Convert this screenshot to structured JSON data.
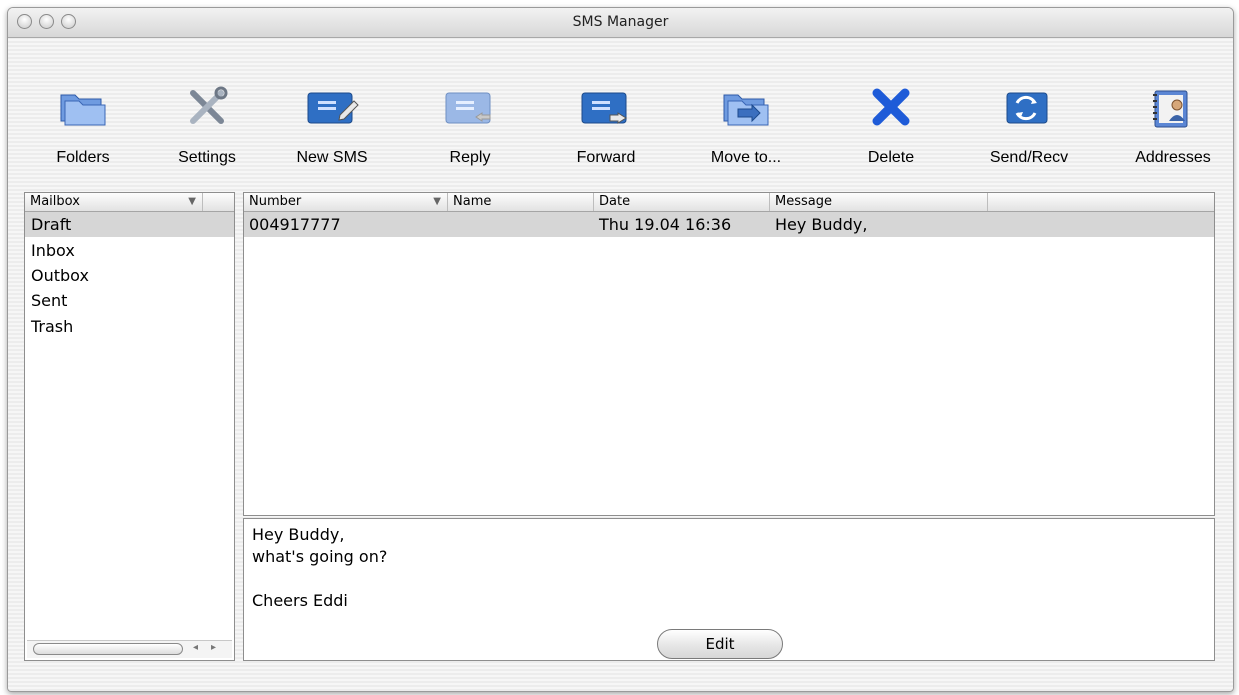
{
  "window": {
    "title": "SMS Manager"
  },
  "toolbar": {
    "items": [
      {
        "label": "Folders",
        "icon": "folders-icon"
      },
      {
        "label": "Settings",
        "icon": "settings-icon"
      },
      {
        "label": "New SMS",
        "icon": "new-sms-icon"
      },
      {
        "label": "Reply",
        "icon": "reply-icon"
      },
      {
        "label": "Forward",
        "icon": "forward-icon"
      },
      {
        "label": "Move to...",
        "icon": "move-to-icon"
      },
      {
        "label": "Delete",
        "icon": "delete-icon"
      },
      {
        "label": "Send/Recv",
        "icon": "send-recv-icon"
      },
      {
        "label": "Addresses",
        "icon": "addresses-icon"
      }
    ]
  },
  "mailbox": {
    "header": "Mailbox",
    "items": [
      "Draft",
      "Inbox",
      "Outbox",
      "Sent",
      "Trash"
    ],
    "selected": "Draft"
  },
  "messages": {
    "columns": [
      "Number",
      "Name",
      "Date",
      "Message"
    ],
    "rows": [
      {
        "number": "004917777",
        "name": "",
        "date": "Thu 19.04 16:36",
        "message": "Hey Buddy,"
      }
    ]
  },
  "preview": {
    "lines": [
      "Hey Buddy,",
      "what's going on?",
      "",
      "Cheers Eddi"
    ]
  },
  "edit_button": {
    "label": "Edit"
  },
  "colors": {
    "accent_blue": "#2f6fc4",
    "selection_gray": "#d6d6d6",
    "delete_blue": "#1e5bd8"
  }
}
